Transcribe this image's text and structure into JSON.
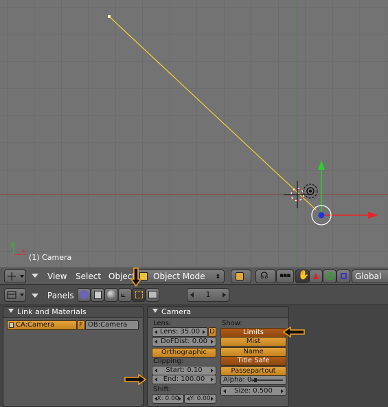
{
  "viewport": {
    "object_label": "(1) Camera"
  },
  "view3d_header": {
    "menus": [
      "View",
      "Select",
      "Object"
    ],
    "mode": "Object Mode",
    "orientation": "Global"
  },
  "buttons_header": {
    "panels_label": "Panels",
    "frame": "1"
  },
  "link_panel": {
    "title": "Link and Materials",
    "camera_field": "CA:Camera",
    "fake_label": "F",
    "object_field": "OB:Camera"
  },
  "camera_panel": {
    "title": "Camera",
    "lens_heading": "Lens:",
    "lens": "Lens: 35.00",
    "lens_toggle": "D",
    "dof": "DoFDist: 0.00",
    "ortho": "Orthographic",
    "clipping_heading": "Clipping:",
    "clip_start": "Start: 0.10",
    "clip_end": "End: 100.00",
    "shift_heading": "Shift:",
    "shift_x": "X: 0.00",
    "shift_y": "Y: 0.00",
    "show_heading": "Show:",
    "limits": "Limits",
    "mist": "Mist",
    "name": "Name",
    "title_safe": "Title Safe",
    "passepartout": "Passepartout",
    "alpha": "Alpha: 0.",
    "size": "Size: 0.500"
  },
  "colors": {
    "viewport_bg": "#737373",
    "grid": "#656565",
    "accent_orange": "#e4a23c",
    "toggle_on": "#9c5215",
    "callout_border": "#f0a020"
  }
}
